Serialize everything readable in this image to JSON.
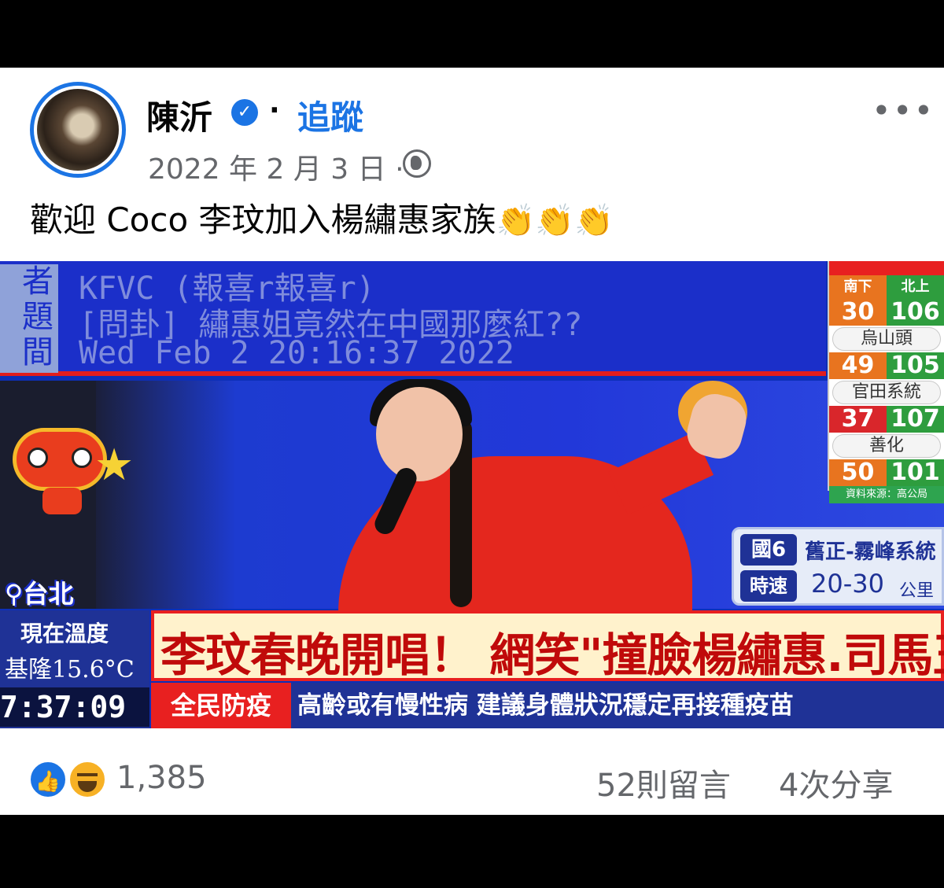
{
  "post": {
    "author": "陳沂",
    "verified_icon": "verified-badge-icon",
    "separator": "·",
    "follow_label": "追蹤",
    "date": "2022 年 2 月 3 日 ·",
    "privacy_icon": "globe-icon",
    "more_label": "•••",
    "caption": "歡迎 Coco 李玟加入楊繡惠家族",
    "caption_emoji": "👏👏👏"
  },
  "media": {
    "ptt": {
      "labels": [
        "者",
        "題",
        "間"
      ],
      "author_line": "KFVC (報喜r報喜r)",
      "title_line": "[問卦] 繡惠姐竟然在中國那麼紅??",
      "time_line": "Wed Feb  2 20:16:37 2022"
    },
    "location": "台北",
    "traffic": {
      "dir_south": "南下",
      "dir_north": "北上",
      "rows": [
        {
          "south": "30",
          "north": "106"
        },
        {
          "name": "烏山頭",
          "south": "49",
          "north": "105"
        },
        {
          "name": "官田系統",
          "south": "37",
          "north": "107"
        },
        {
          "name": "善化",
          "south": "50",
          "north": "101"
        }
      ],
      "source": "資料來源：高公局"
    },
    "highway": {
      "route": "國6",
      "segment": "舊正-霧峰系統",
      "speed_label": "時速",
      "speed": "20-30",
      "unit": "公里"
    },
    "weather": {
      "title": "現在溫度",
      "temp": "基隆15.6°C",
      "time": "7:37:09"
    },
    "headline": "李玟春晚開唱！ 網笑\"撞臉楊繡惠.司馬玉嬌\"",
    "sub_tag": "全民防疫",
    "sub_text": "高齡或有慢性病 建議身體狀況穩定再接種疫苗"
  },
  "footer": {
    "reaction_count": "1,385",
    "comments": "52則留言",
    "shares": "4次分享"
  },
  "colors": {
    "brand_blue": "#1b74e4",
    "meta_gray": "#65676b",
    "headline_red": "#c00a0a",
    "ticker_blue": "#1f3296"
  }
}
